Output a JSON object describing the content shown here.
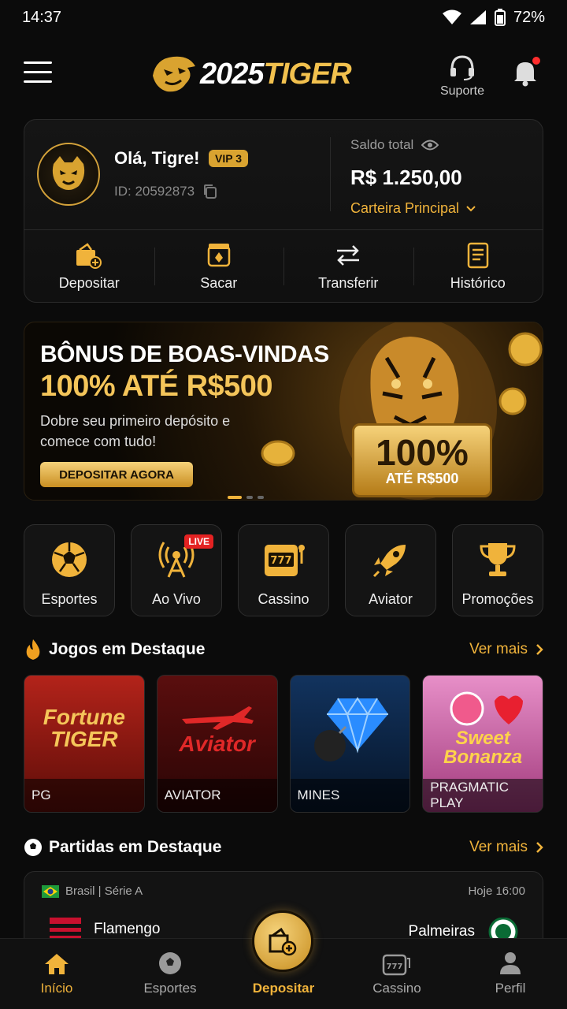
{
  "status_bar": {
    "time": "14:37",
    "battery": "72%"
  },
  "header": {
    "logo_part1": "2025",
    "logo_part2": "TIGER",
    "support_label": "Suporte"
  },
  "account": {
    "greeting": "Olá, Tigre!",
    "vip": "VIP 3",
    "user_id": "ID: 20592873",
    "balance_label": "Saldo total",
    "balance_value": "R$ 1.250,00",
    "wallet_label": "Carteira Principal",
    "actions": [
      {
        "label": "Depositar",
        "icon": "wallet-plus-icon"
      },
      {
        "label": "Sacar",
        "icon": "withdraw-icon"
      },
      {
        "label": "Transferir",
        "icon": "transfer-icon"
      },
      {
        "label": "Histórico",
        "icon": "history-icon"
      }
    ]
  },
  "banner": {
    "title": "BÔNUS DE BOAS-VINDAS",
    "highlight": "100% ATÉ R$500",
    "text": "Dobre seu primeiro depósito e comece com tudo!",
    "cta": "DEPOSITAR AGORA",
    "ticket_big": "100%",
    "ticket_small": "ATÉ R$500"
  },
  "categories": [
    {
      "label": "Esportes",
      "icon": "soccer-ball-icon"
    },
    {
      "label": "Ao Vivo",
      "icon": "broadcast-icon",
      "badge": "LIVE"
    },
    {
      "label": "Cassino",
      "icon": "slot-machine-icon"
    },
    {
      "label": "Aviator",
      "icon": "rocket-icon"
    },
    {
      "label": "Promoções",
      "icon": "trophy-icon"
    }
  ],
  "featured_games": {
    "title": "Jogos em Destaque",
    "more": "Ver mais",
    "items": [
      {
        "provider": "PG",
        "art_title": "Fortune TIGER",
        "color": "#8e1a12"
      },
      {
        "provider": "AVIATOR",
        "art_title": "Aviator",
        "color": "#4a0b0b"
      },
      {
        "provider": "MINES",
        "art_title": "",
        "color": "#0d2a54"
      },
      {
        "provider": "PRAGMATIC PLAY",
        "art_title": "Sweet Bonanza",
        "color": "#a8367a"
      }
    ]
  },
  "featured_matches": {
    "title": "Partidas em Destaque",
    "more": "Ver mais",
    "match": {
      "league": "Brasil | Série A",
      "time": "Hoje 16:00",
      "home": "Flamengo",
      "away": "Palmeiras"
    }
  },
  "bottom_nav": [
    {
      "label": "Início",
      "icon": "home-icon"
    },
    {
      "label": "Esportes",
      "icon": "soccer-ball-icon"
    },
    {
      "label": "Depositar",
      "icon": "wallet-plus-icon"
    },
    {
      "label": "Cassino",
      "icon": "slot-machine-icon"
    },
    {
      "label": "Perfil",
      "icon": "user-icon"
    }
  ],
  "colors": {
    "gold": "#f0b33b",
    "background": "#0b0b0b",
    "live": "#e42222"
  }
}
